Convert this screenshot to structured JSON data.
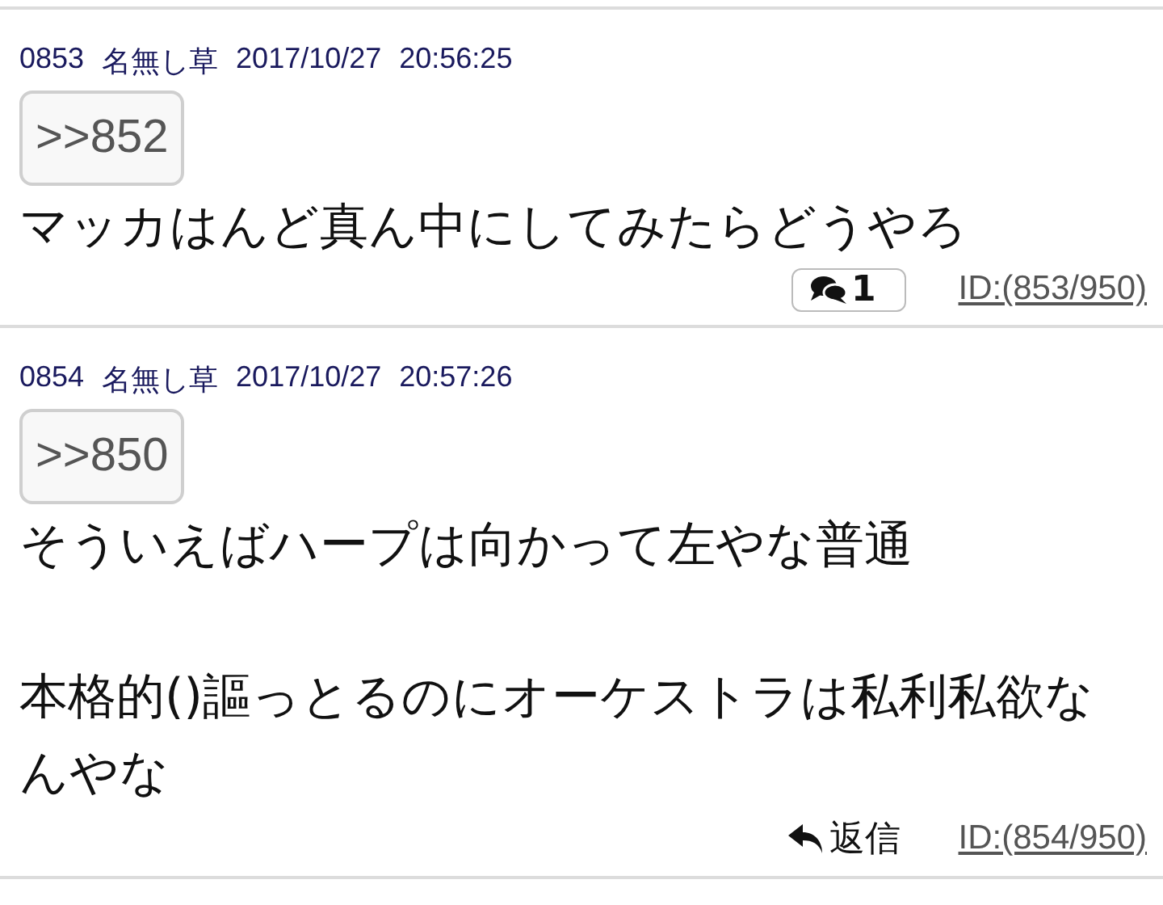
{
  "posts": [
    {
      "number": "0853",
      "name": "名無し草",
      "date": "2017/10/27",
      "time": "20:56:25",
      "anchor": ">>852",
      "body": [
        "マッカはんど真ん中にしてみたらどうやろ"
      ],
      "action": {
        "kind": "replies",
        "label": "1"
      },
      "id_link": "ID:(853/950)"
    },
    {
      "number": "0854",
      "name": "名無し草",
      "date": "2017/10/27",
      "time": "20:57:26",
      "anchor": ">>850",
      "body": [
        "そういえばハープは向かって左やな普通",
        "本格的()謳っとるのにオーケストラは私利私欲なんやな"
      ],
      "action": {
        "kind": "reply",
        "label": "返信"
      },
      "id_link": "ID:(854/950)"
    }
  ]
}
